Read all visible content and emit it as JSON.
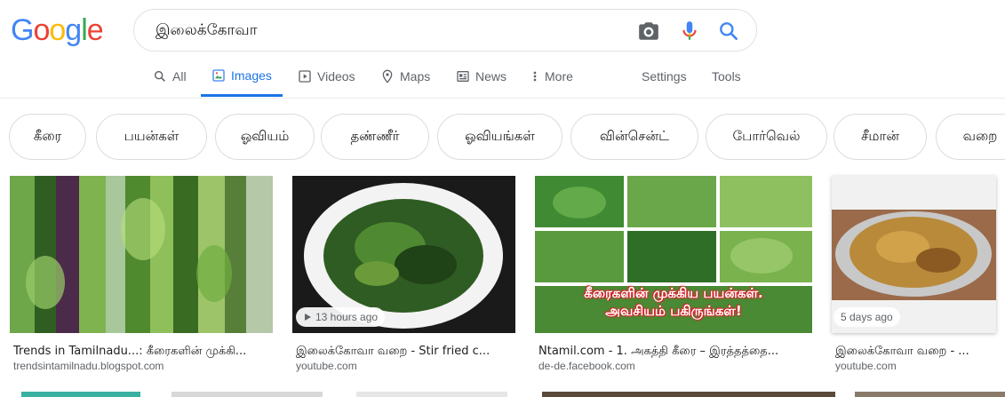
{
  "logo": {
    "letters": [
      "G",
      "o",
      "o",
      "g",
      "l",
      "e"
    ],
    "colors": [
      "#4285F4",
      "#EA4335",
      "#FBBC05",
      "#4285F4",
      "#34A853",
      "#EA4335"
    ]
  },
  "search": {
    "query": "இலைக்கோவா"
  },
  "tabs": [
    {
      "label": "All",
      "icon": "search-icon"
    },
    {
      "label": "Images",
      "icon": "image-icon",
      "active": true
    },
    {
      "label": "Videos",
      "icon": "video-icon"
    },
    {
      "label": "Maps",
      "icon": "map-pin-icon"
    },
    {
      "label": "News",
      "icon": "news-icon"
    },
    {
      "label": "More",
      "icon": "more-vert-icon"
    },
    {
      "label": "Settings"
    },
    {
      "label": "Tools"
    }
  ],
  "chips": [
    "கீரை",
    "பயன்கள்",
    "ஓவியம்",
    "தண்ணீர்",
    "ஓவியங்கள்",
    "வின்சென்ட்",
    "போர்வெல்",
    "சீமான்",
    "வறை"
  ],
  "results": [
    {
      "title": "Trends in Tamilnadu...: கீரைகளின் முக்கி...",
      "source": "trendsintamilnadu.blogspot.com"
    },
    {
      "title": "இலைக்கோவா வறை - Stir fried c...",
      "source": "youtube.com",
      "badge": "13 hours ago"
    },
    {
      "title": "Ntamil.com - 1. அகத்தி கீரை – இரத்தத்தை...",
      "source": "de-de.facebook.com",
      "overlay": [
        "கீரைகளின் முக்கிய பயன்கள்.",
        "அவசியம் பகிருங்கள்!"
      ]
    },
    {
      "title": "இலைக்கோவா வறை - ...",
      "source": "youtube.com",
      "badge": "5 days ago"
    }
  ],
  "colors": {
    "accent": "#1a73e8",
    "muted": "#5f6368"
  }
}
